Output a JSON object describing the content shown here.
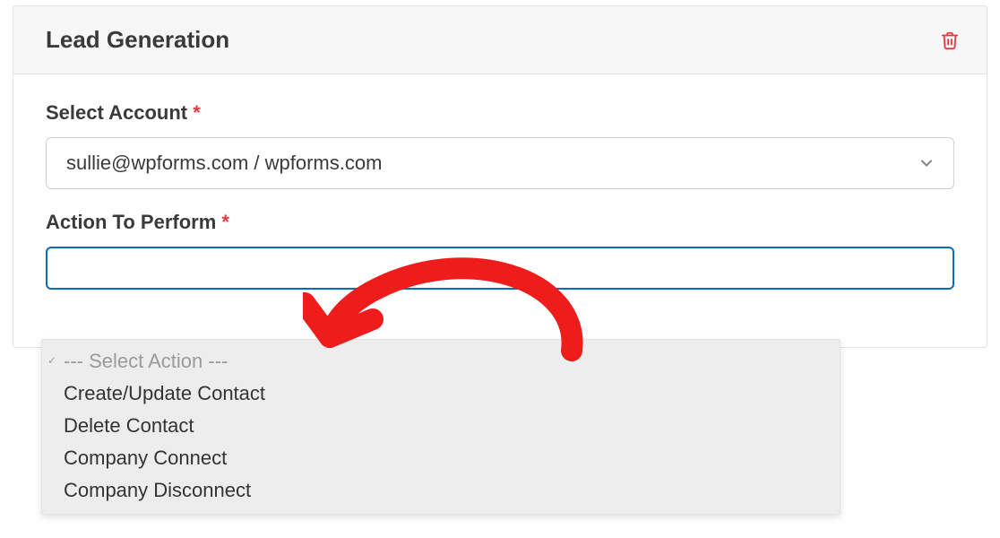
{
  "panel": {
    "title": "Lead Generation"
  },
  "account": {
    "label": "Select Account",
    "required": "*",
    "value": "sullie@wpforms.com / wpforms.com"
  },
  "action": {
    "label": "Action To Perform",
    "required": "*",
    "placeholder": "--- Select Action ---",
    "options": {
      "0": "Create/Update Contact",
      "1": "Delete Contact",
      "2": "Company Connect",
      "3": "Company Disconnect"
    }
  }
}
